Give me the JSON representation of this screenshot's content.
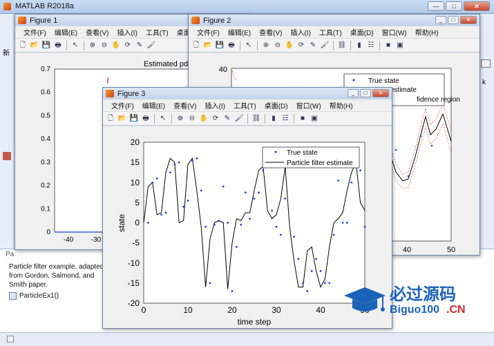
{
  "matlab": {
    "title": "MATLAB R2018a",
    "side_letters": [
      "新",
      "k"
    ],
    "help_text": [
      "Particle filter example, adapted",
      "from Gordon, Salmond, and",
      "Smith paper."
    ],
    "help_link": "ParticleEx1()",
    "pa_label": "Pa"
  },
  "menu_items": [
    "文件(F)",
    "编辑(E)",
    "查看(V)",
    "插入(I)",
    "工具(T)",
    "桌面(D)",
    "窗口(W)",
    "帮助(H)"
  ],
  "figure1": {
    "title": "Figure 1",
    "plot_title": "Estimated pdf at k",
    "y_ticks": [
      "0.7",
      "0.6",
      "0.5",
      "0.4",
      "0.3",
      "0.2",
      "0.1",
      "0"
    ],
    "x_ticks": [
      "-40",
      "-30"
    ]
  },
  "figure2": {
    "title": "Figure 2",
    "y_top": "40",
    "x_ticks": [
      "40",
      "50"
    ],
    "legend": [
      "True state",
      "EKF estimate",
      "95% confidence region"
    ],
    "legend_visible": [
      "True state",
      "estimate",
      "fidence region"
    ]
  },
  "figure3": {
    "title": "Figure 3",
    "legend": [
      "True state",
      "Particle filter estimate"
    ]
  },
  "chart_data": {
    "type": "line",
    "xlabel": "time step",
    "ylabel": "state",
    "xlim": [
      0,
      50
    ],
    "ylim": [
      -20,
      20
    ],
    "x_ticks": [
      0,
      10,
      20,
      30,
      40,
      50
    ],
    "y_ticks": [
      20,
      15,
      10,
      5,
      0,
      -5,
      -10,
      -15,
      -20
    ],
    "legend_position": "top-right",
    "colors": {
      "true_state": "#1f3fd6",
      "estimate": "#000000"
    },
    "series": [
      {
        "name": "True state",
        "style": "points",
        "x": [
          1,
          2,
          3,
          4,
          5,
          6,
          7,
          8,
          9,
          10,
          11,
          12,
          13,
          14,
          15,
          16,
          17,
          18,
          19,
          20,
          21,
          22,
          23,
          24,
          25,
          26,
          27,
          28,
          29,
          30,
          31,
          32,
          33,
          34,
          35,
          36,
          37,
          38,
          39,
          40,
          41,
          42,
          43,
          44,
          45,
          46,
          47,
          48,
          49,
          50
        ],
        "y": [
          0,
          10,
          11,
          2,
          2.5,
          12.5,
          14.5,
          15,
          4,
          5.5,
          15.5,
          16,
          8,
          -1,
          -15,
          -0.5,
          0.5,
          9,
          0,
          -17,
          -6,
          -0.5,
          7.5,
          1,
          6,
          7.5,
          13,
          17,
          3,
          -1,
          -3,
          6,
          15,
          -3.5,
          -9,
          -15,
          -17,
          -12,
          -9,
          -12,
          -15,
          -15,
          -3,
          10.5,
          0,
          0,
          10,
          15,
          13,
          -1
        ]
      },
      {
        "name": "Particle filter estimate",
        "style": "line",
        "x": [
          0,
          1,
          2,
          3,
          4,
          5,
          6,
          7,
          8,
          9,
          10,
          11,
          12,
          13,
          14,
          15,
          16,
          17,
          18,
          19,
          20,
          21,
          22,
          23,
          24,
          25,
          26,
          27,
          28,
          29,
          30,
          31,
          32,
          33,
          34,
          35,
          36,
          37,
          38,
          39,
          40,
          41,
          42,
          43,
          44,
          45,
          46,
          47,
          48,
          49,
          50
        ],
        "y": [
          0,
          9,
          10,
          2,
          2.5,
          12.5,
          16,
          15,
          0,
          0.5,
          14.5,
          16,
          8,
          -1,
          -16,
          -4,
          0,
          0.5,
          0,
          -16.5,
          -5,
          1,
          0.5,
          2.5,
          2.5,
          8,
          13,
          14,
          3,
          1,
          2,
          6,
          14,
          -1,
          -9.5,
          -16,
          -16,
          -7,
          -6,
          -12,
          -16,
          -14,
          -6,
          0,
          1,
          2.5,
          8,
          12.5,
          15,
          5,
          3
        ]
      }
    ]
  },
  "watermark": {
    "brand": "必过源码",
    "site": "Biguo100",
    "tld": ".CN"
  }
}
